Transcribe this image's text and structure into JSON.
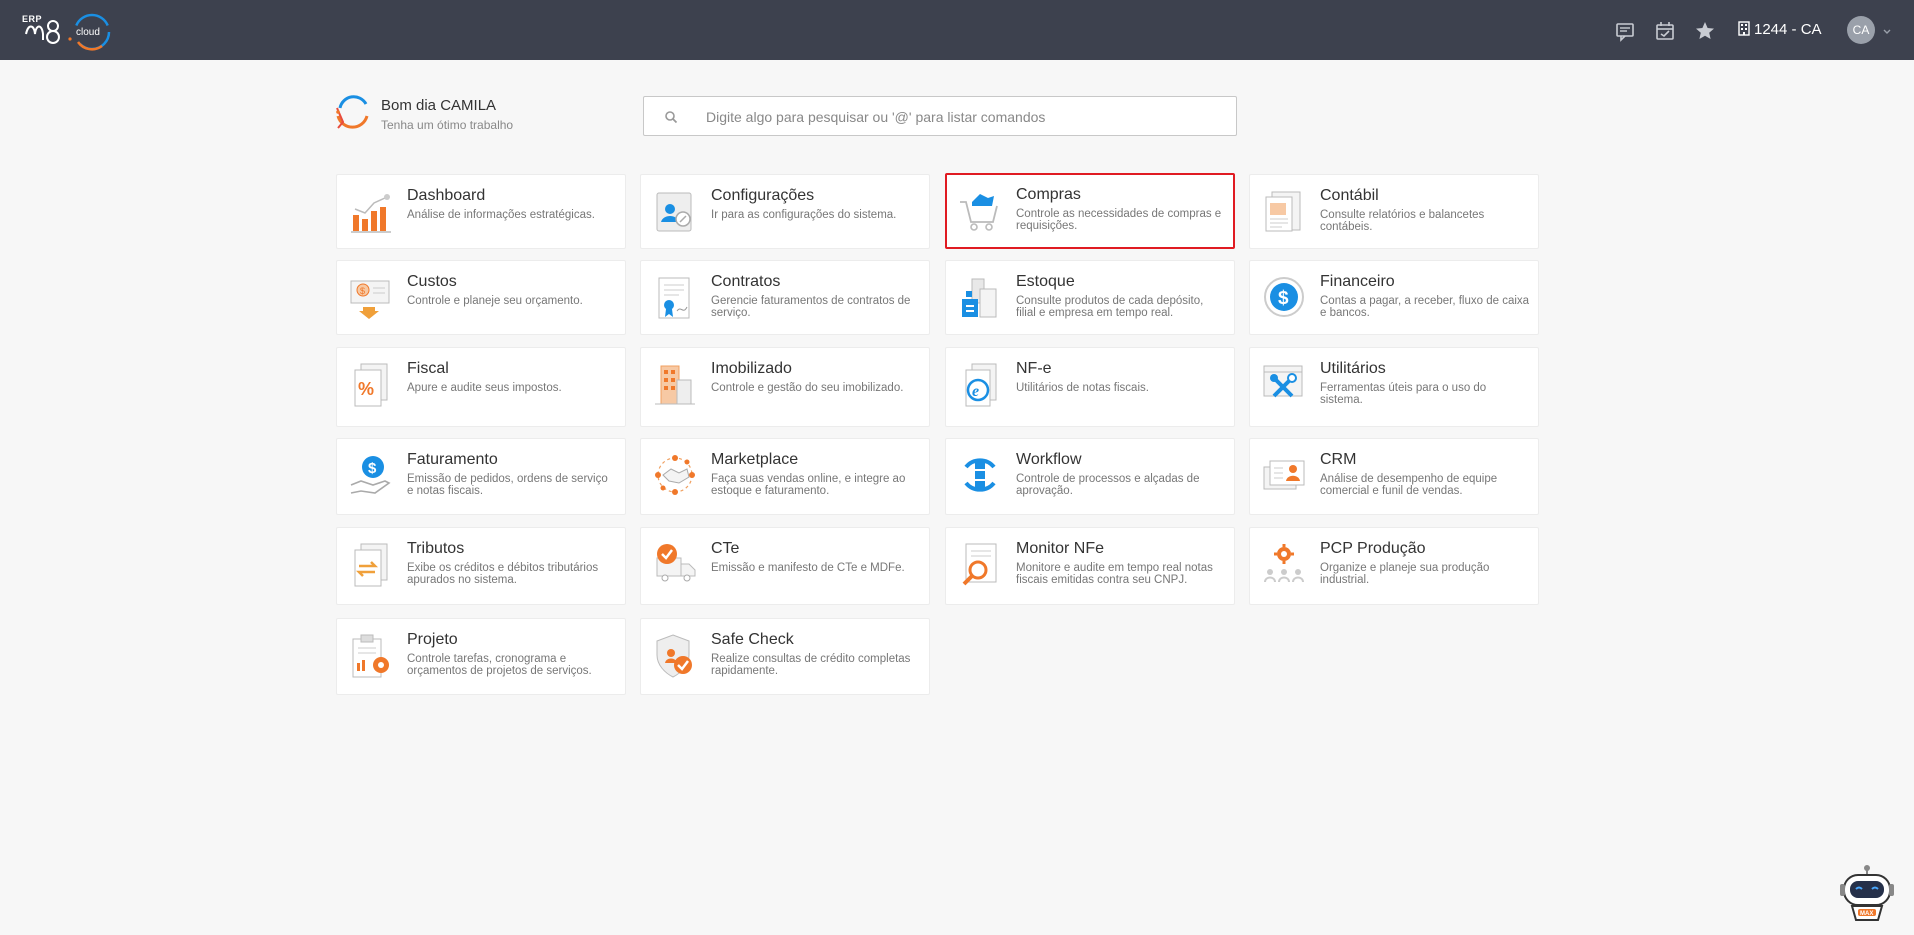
{
  "app": {
    "logo_erp": "ERP",
    "logo_text": "m8 cloud",
    "colors": {
      "topbar": "#3d414e",
      "accent_orange": "#f0782a",
      "accent_blue": "#1a8fe3",
      "highlight": "#e01b22"
    }
  },
  "header": {
    "icons": [
      "chat-icon",
      "calendar-check-icon",
      "star-icon",
      "building-icon"
    ],
    "company": "1244 - CA",
    "avatar": "CA"
  },
  "greeting": {
    "title": "Bom dia CAMILA",
    "subtitle": "Tenha um ótimo trabalho"
  },
  "search": {
    "placeholder": "Digite algo para pesquisar ou '@' para listar comandos",
    "value": ""
  },
  "modules": [
    {
      "title": "Dashboard",
      "desc": "Análise de informações estratégicas.",
      "icon": "chart-bars-icon"
    },
    {
      "title": "Configurações",
      "desc": "Ir para as configurações do sistema.",
      "icon": "settings-profile-icon"
    },
    {
      "title": "Compras",
      "desc": "Controle as necessidades de compras e requisições.",
      "icon": "shopping-cart-icon",
      "selected": true
    },
    {
      "title": "Contábil",
      "desc": "Consulte relatórios e balancetes contábeis.",
      "icon": "ledger-document-icon"
    },
    {
      "title": "Custos",
      "desc": "Controle e planeje seu orçamento.",
      "icon": "money-down-icon"
    },
    {
      "title": "Contratos",
      "desc": "Gerencie faturamentos de contratos de serviço.",
      "icon": "contract-icon"
    },
    {
      "title": "Estoque",
      "desc": "Consulte produtos de cada depósito, filial e empresa em tempo real.",
      "icon": "warehouse-icon"
    },
    {
      "title": "Financeiro",
      "desc": "Contas a pagar, a receber, fluxo de caixa e bancos.",
      "icon": "dollar-circle-icon"
    },
    {
      "title": "Fiscal",
      "desc": "Apure e audite seus impostos.",
      "icon": "percent-document-icon"
    },
    {
      "title": "Imobilizado",
      "desc": "Controle e gestão do seu imobilizado.",
      "icon": "buildings-icon"
    },
    {
      "title": "NF-e",
      "desc": "Utilitários de notas fiscais.",
      "icon": "e-document-icon"
    },
    {
      "title": "Utilitários",
      "desc": "Ferramentas úteis para o uso do sistema.",
      "icon": "tools-icon"
    },
    {
      "title": "Faturamento",
      "desc": "Emissão de pedidos, ordens de serviço e notas fiscais.",
      "icon": "hand-dollar-icon"
    },
    {
      "title": "Marketplace",
      "desc": "Faça suas vendas online, e integre ao estoque e faturamento.",
      "icon": "handshake-icon"
    },
    {
      "title": "Workflow",
      "desc": "Controle de processos e alçadas de aprovação.",
      "icon": "workflow-icon"
    },
    {
      "title": "CRM",
      "desc": "Análise de desempenho de equipe comercial e funil de vendas.",
      "icon": "contact-cards-icon"
    },
    {
      "title": "Tributos",
      "desc": "Exibe os créditos e débitos tributários apurados no sistema.",
      "icon": "exchange-document-icon"
    },
    {
      "title": "CTe",
      "desc": "Emissão e manifesto de CTe e MDFe.",
      "icon": "truck-check-icon"
    },
    {
      "title": "Monitor NFe",
      "desc": "Monitore e audite em tempo real notas fiscais emitidas contra seu CNPJ.",
      "icon": "magnifier-document-icon"
    },
    {
      "title": "PCP Produção",
      "desc": "Organize e planeje sua produção industrial.",
      "icon": "production-gear-icon"
    },
    {
      "title": "Projeto",
      "desc": "Controle tarefas, cronograma e orçamentos de projetos de serviços.",
      "icon": "clipboard-gear-icon"
    },
    {
      "title": "Safe Check",
      "desc": "Realize consultas de crédito completas rapidamente.",
      "icon": "shield-check-icon"
    }
  ],
  "assistant": {
    "icon": "robot-assistant-icon",
    "label": "MAX"
  }
}
